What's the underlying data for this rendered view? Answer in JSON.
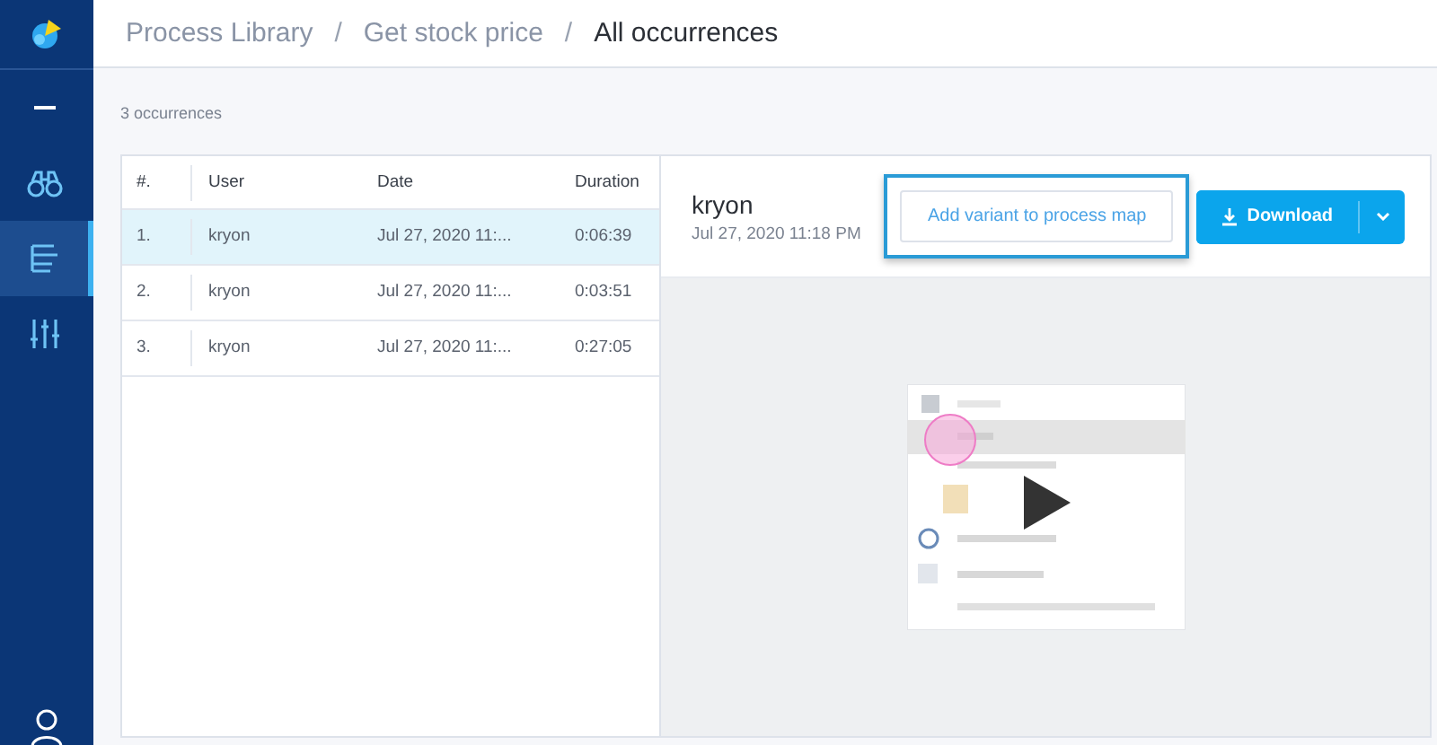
{
  "breadcrumb": [
    {
      "label": "Process Library",
      "current": false
    },
    {
      "label": "/",
      "kind": "separator"
    },
    {
      "label": "Get stock price",
      "current": false
    },
    {
      "label": "/",
      "kind": "separator"
    },
    {
      "label": "All occurrences",
      "current": true
    }
  ],
  "sidebar": {
    "items": [
      {
        "kind": "minus",
        "selected": false
      },
      {
        "kind": "binoculars",
        "selected": false
      },
      {
        "kind": "tree",
        "selected": true
      },
      {
        "kind": "sliders",
        "selected": false
      }
    ]
  },
  "count": "3 occurrences",
  "table": {
    "columns": [
      "#.",
      "User",
      "Date",
      "Duration"
    ],
    "rows": [
      {
        "cells": [
          "1.",
          "kryon",
          "Jul 27, 2020 11:...",
          "0:06:39"
        ],
        "selected": true
      },
      {
        "cells": [
          "2.",
          "kryon",
          "Jul 27, 2020 11:...",
          "0:03:51"
        ],
        "selected": false
      },
      {
        "cells": [
          "3.",
          "kryon",
          "Jul 27, 2020 11:...",
          "0:27:05"
        ],
        "selected": false
      }
    ]
  },
  "detail": {
    "user": "kryon",
    "date": "Jul 27, 2020 11:18 PM",
    "add_button": "Add variant to process map",
    "add_highlighted": true,
    "download_button": "Download"
  }
}
